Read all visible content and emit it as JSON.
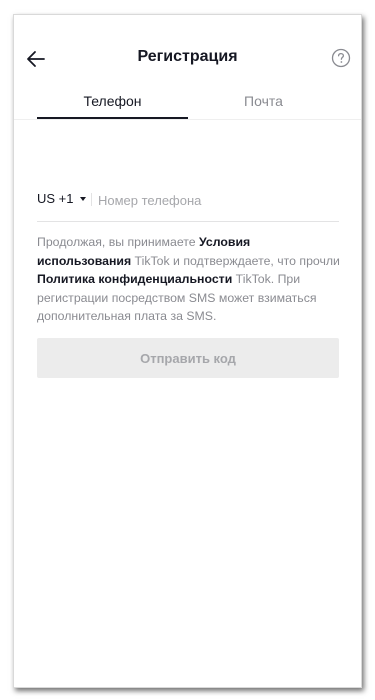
{
  "header": {
    "title": "Регистрация"
  },
  "tabs": [
    {
      "label": "Телефон",
      "active": true
    },
    {
      "label": "Почта",
      "active": false
    }
  ],
  "phone": {
    "country_code": "US +1",
    "placeholder": "Номер телефона",
    "value": ""
  },
  "terms": {
    "part1": "Продолжая, вы принимаете ",
    "terms_link": "Условия использования",
    "part2": " TikTok и подтверждаете, что прочли ",
    "privacy_link": "Политика конфиденциальности",
    "part3": " TikTok. При регистрации посредством SMS может взиматься дополнительная плата за SMS."
  },
  "send_button": {
    "label": "Отправить код",
    "enabled": false
  },
  "icons": {
    "back": "arrow-left-icon",
    "help": "question-circle-icon"
  },
  "colors": {
    "text_primary": "#161823",
    "text_secondary": "#8a8b91",
    "button_disabled_bg": "#ececec",
    "button_disabled_text": "#a6a7ab"
  }
}
